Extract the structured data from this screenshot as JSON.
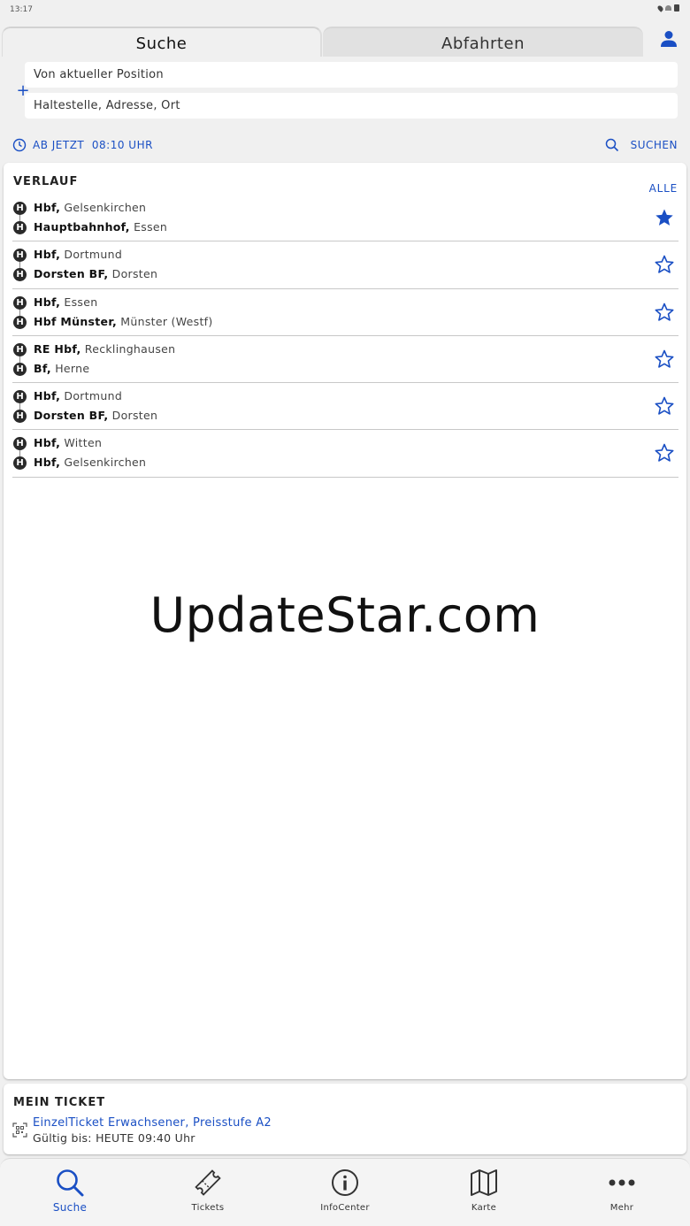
{
  "status_bar": {
    "time": "13:17"
  },
  "tabs": [
    {
      "label": "Suche",
      "active": true
    },
    {
      "label": "Abfahrten",
      "active": false
    }
  ],
  "search": {
    "from_placeholder": "Von aktueller Position",
    "to_placeholder": "Haltestelle, Adresse, Ort",
    "time_label": "AB JETZT  08:10 UHR",
    "search_label": "SUCHEN"
  },
  "history": {
    "title": "VERLAUF",
    "all_label": "ALLE",
    "items": [
      {
        "from_bold": "Hbf,",
        "from_rest": " Gelsenkirchen",
        "to_bold": "Hauptbahnhof,",
        "to_rest": " Essen",
        "favorite": true
      },
      {
        "from_bold": "Hbf,",
        "from_rest": " Dortmund",
        "to_bold": "Dorsten BF,",
        "to_rest": " Dorsten",
        "favorite": false
      },
      {
        "from_bold": "Hbf,",
        "from_rest": " Essen",
        "to_bold": "Hbf Münster,",
        "to_rest": " Münster (Westf)",
        "favorite": false
      },
      {
        "from_bold": "RE Hbf,",
        "from_rest": " Recklinghausen",
        "to_bold": "Bf,",
        "to_rest": " Herne",
        "favorite": false
      },
      {
        "from_bold": "Hbf,",
        "from_rest": " Dortmund",
        "to_bold": "Dorsten BF,",
        "to_rest": " Dorsten",
        "favorite": false
      },
      {
        "from_bold": "Hbf,",
        "from_rest": " Witten",
        "to_bold": "Hbf,",
        "to_rest": " Gelsenkirchen",
        "favorite": false
      }
    ],
    "stop_badge": "H"
  },
  "watermark": "UpdateStar.com",
  "ticket": {
    "title": "MEIN TICKET",
    "name": "EinzelTicket Erwachsener, Preisstufe A2",
    "valid": "Gültig bis: HEUTE 09:40 Uhr"
  },
  "bottom_nav": [
    {
      "label": "Suche",
      "icon": "search-icon",
      "active": true
    },
    {
      "label": "Tickets",
      "icon": "ticket-icon",
      "active": false
    },
    {
      "label": "InfoCenter",
      "icon": "info-icon",
      "active": false
    },
    {
      "label": "Karte",
      "icon": "map-icon",
      "active": false
    },
    {
      "label": "Mehr",
      "icon": "more-icon",
      "active": false
    }
  ],
  "colors": {
    "accent": "#1a4fc4",
    "background": "#f0f0f0",
    "card": "#ffffff"
  }
}
